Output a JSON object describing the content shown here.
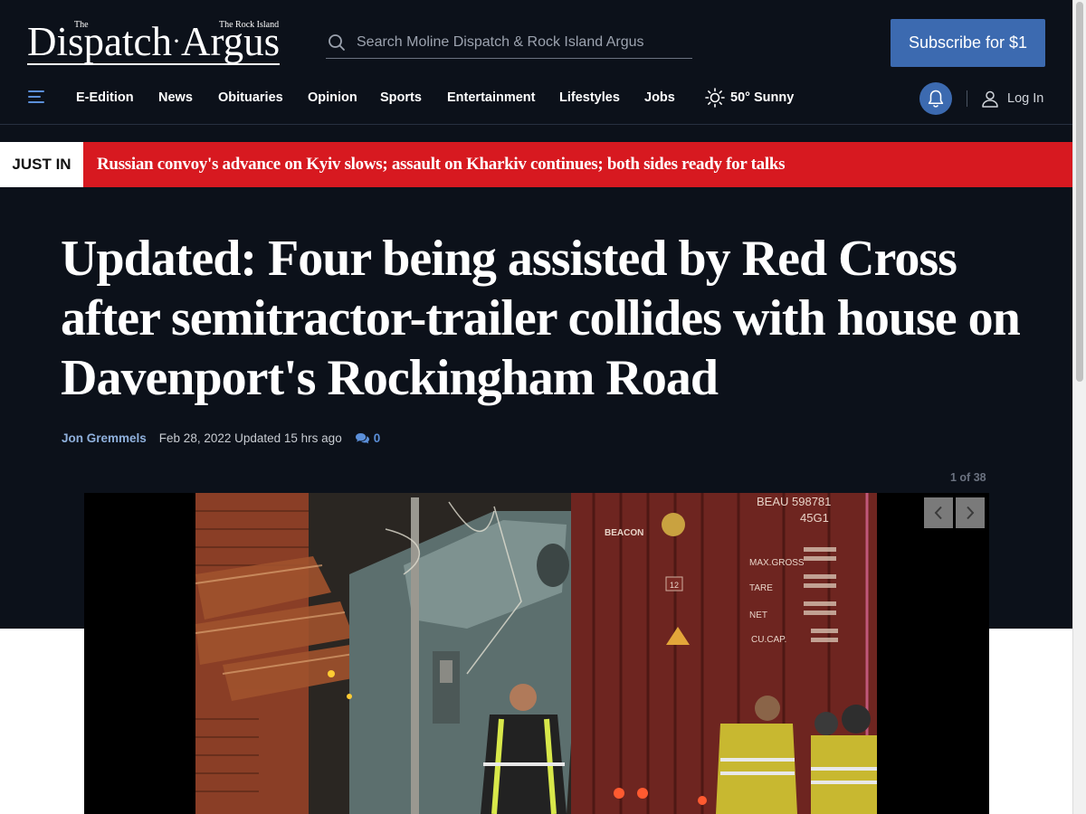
{
  "logo": {
    "the": "The",
    "rock_island": "The Rock Island",
    "dispatch": "Dispatch",
    "separator": "·",
    "argus": "Argus"
  },
  "search": {
    "placeholder": "Search Moline Dispatch & Rock Island Argus",
    "icon": "search-icon"
  },
  "subscribe": {
    "label": "Subscribe for $1",
    "color": "#3c6ab0"
  },
  "nav": {
    "items": [
      "E-Edition",
      "News",
      "Obituaries",
      "Opinion",
      "Sports",
      "Entertainment",
      "Lifestyles",
      "Jobs"
    ],
    "weather": "50° Sunny",
    "login": "Log In"
  },
  "just_in": {
    "label": "JUST IN",
    "headline": "Russian convoy's advance on Kyiv slows; assault on Kharkiv continues; both sides ready for talks",
    "color": "#d71920"
  },
  "article": {
    "headline": "Updated: Four being assisted by Red Cross after semitractor-trailer collides with house on Davenport's Rockingham Road",
    "author": "Jon Gremmels",
    "date": "Feb 28, 2022 Updated 15 hrs ago",
    "comment_count": "0"
  },
  "gallery": {
    "counter": "1 of 38",
    "trailer_text": {
      "line1": "BEAU 598781",
      "line2": "45G1",
      "brand": "BEACON",
      "maxgross": "MAX.GROSS",
      "tare": "TARE",
      "net": "NET",
      "cucap": "CU.CAP.",
      "badge": "12"
    }
  },
  "colors": {
    "background": "#0c111a",
    "accent": "#3c6ab0",
    "author": "#8fb0dc"
  }
}
